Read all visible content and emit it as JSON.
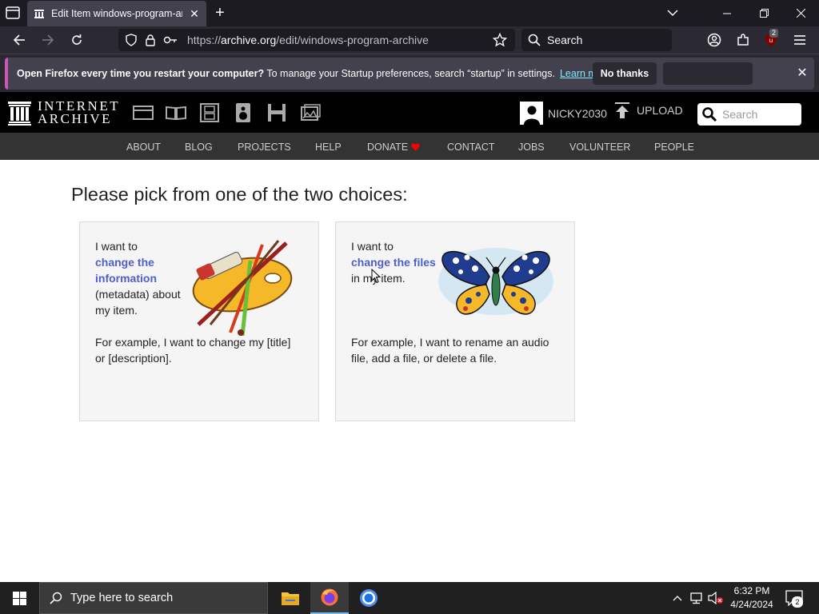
{
  "browser": {
    "tab": {
      "title": "Edit Item windows-program-arc",
      "icon": "archive-icon"
    },
    "url": {
      "prefix": "https://",
      "host": "archive.org",
      "path": "/edit/windows-program-archive"
    },
    "search_placeholder": "Search",
    "extension_badge": "2"
  },
  "notification": {
    "bold": "Open Firefox every time you restart your computer?",
    "text": " To manage your Startup preferences, search “startup” in settings.",
    "link": "Learn more",
    "no_thanks": "No thanks",
    "accent_color": "#c957b3"
  },
  "ia_header": {
    "logo_line1": "INTERNET",
    "logo_line2": "ARCHIVE",
    "media_icons": [
      "web-icon",
      "texts-icon",
      "video-icon",
      "audio-icon",
      "software-icon",
      "images-icon"
    ],
    "username": "NICKY2030",
    "upload": "UPLOAD",
    "search_placeholder": "Search"
  },
  "ia_nav": [
    "ABOUT",
    "BLOG",
    "PROJECTS",
    "HELP",
    "DONATE",
    "CONTACT",
    "JOBS",
    "VOLUNTEER",
    "PEOPLE"
  ],
  "main": {
    "title": "Please pick from one of the two choices:",
    "choices": [
      {
        "pre": "I want to",
        "link": "change the information",
        "post": "(metadata) about my item.",
        "example": "For example, I want to change my [title] or [description]."
      },
      {
        "pre": "I want to",
        "link": "change the files",
        "post": "in my item.",
        "example": "For example, I want to rename an audio file, add a file, or delete a file."
      }
    ]
  },
  "taskbar": {
    "search_placeholder": "Type here to search",
    "time": "6:32 PM",
    "date": "4/24/2024",
    "notification_count": "2"
  }
}
